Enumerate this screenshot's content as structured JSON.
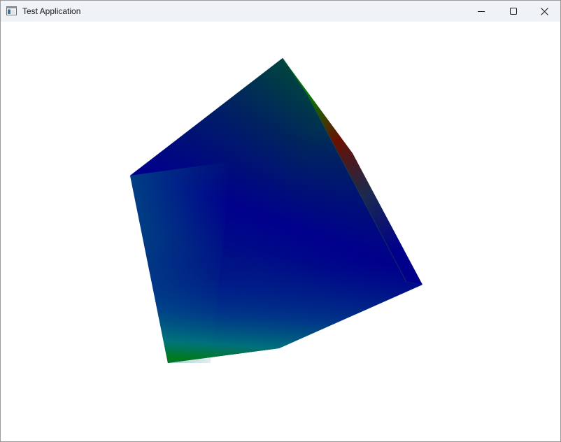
{
  "window": {
    "title": "Test Application",
    "icon": "application-window-icon",
    "controls": [
      "minimize-icon",
      "maximize-icon",
      "close-icon"
    ]
  },
  "scene": {
    "object": "rotating-cube",
    "background_color": "#ffffff",
    "colors": {
      "blue": "#00008a",
      "green": "#007a00",
      "red": "#7a0000",
      "teal": "#007a7a",
      "dark_teal": "#003a55"
    }
  }
}
